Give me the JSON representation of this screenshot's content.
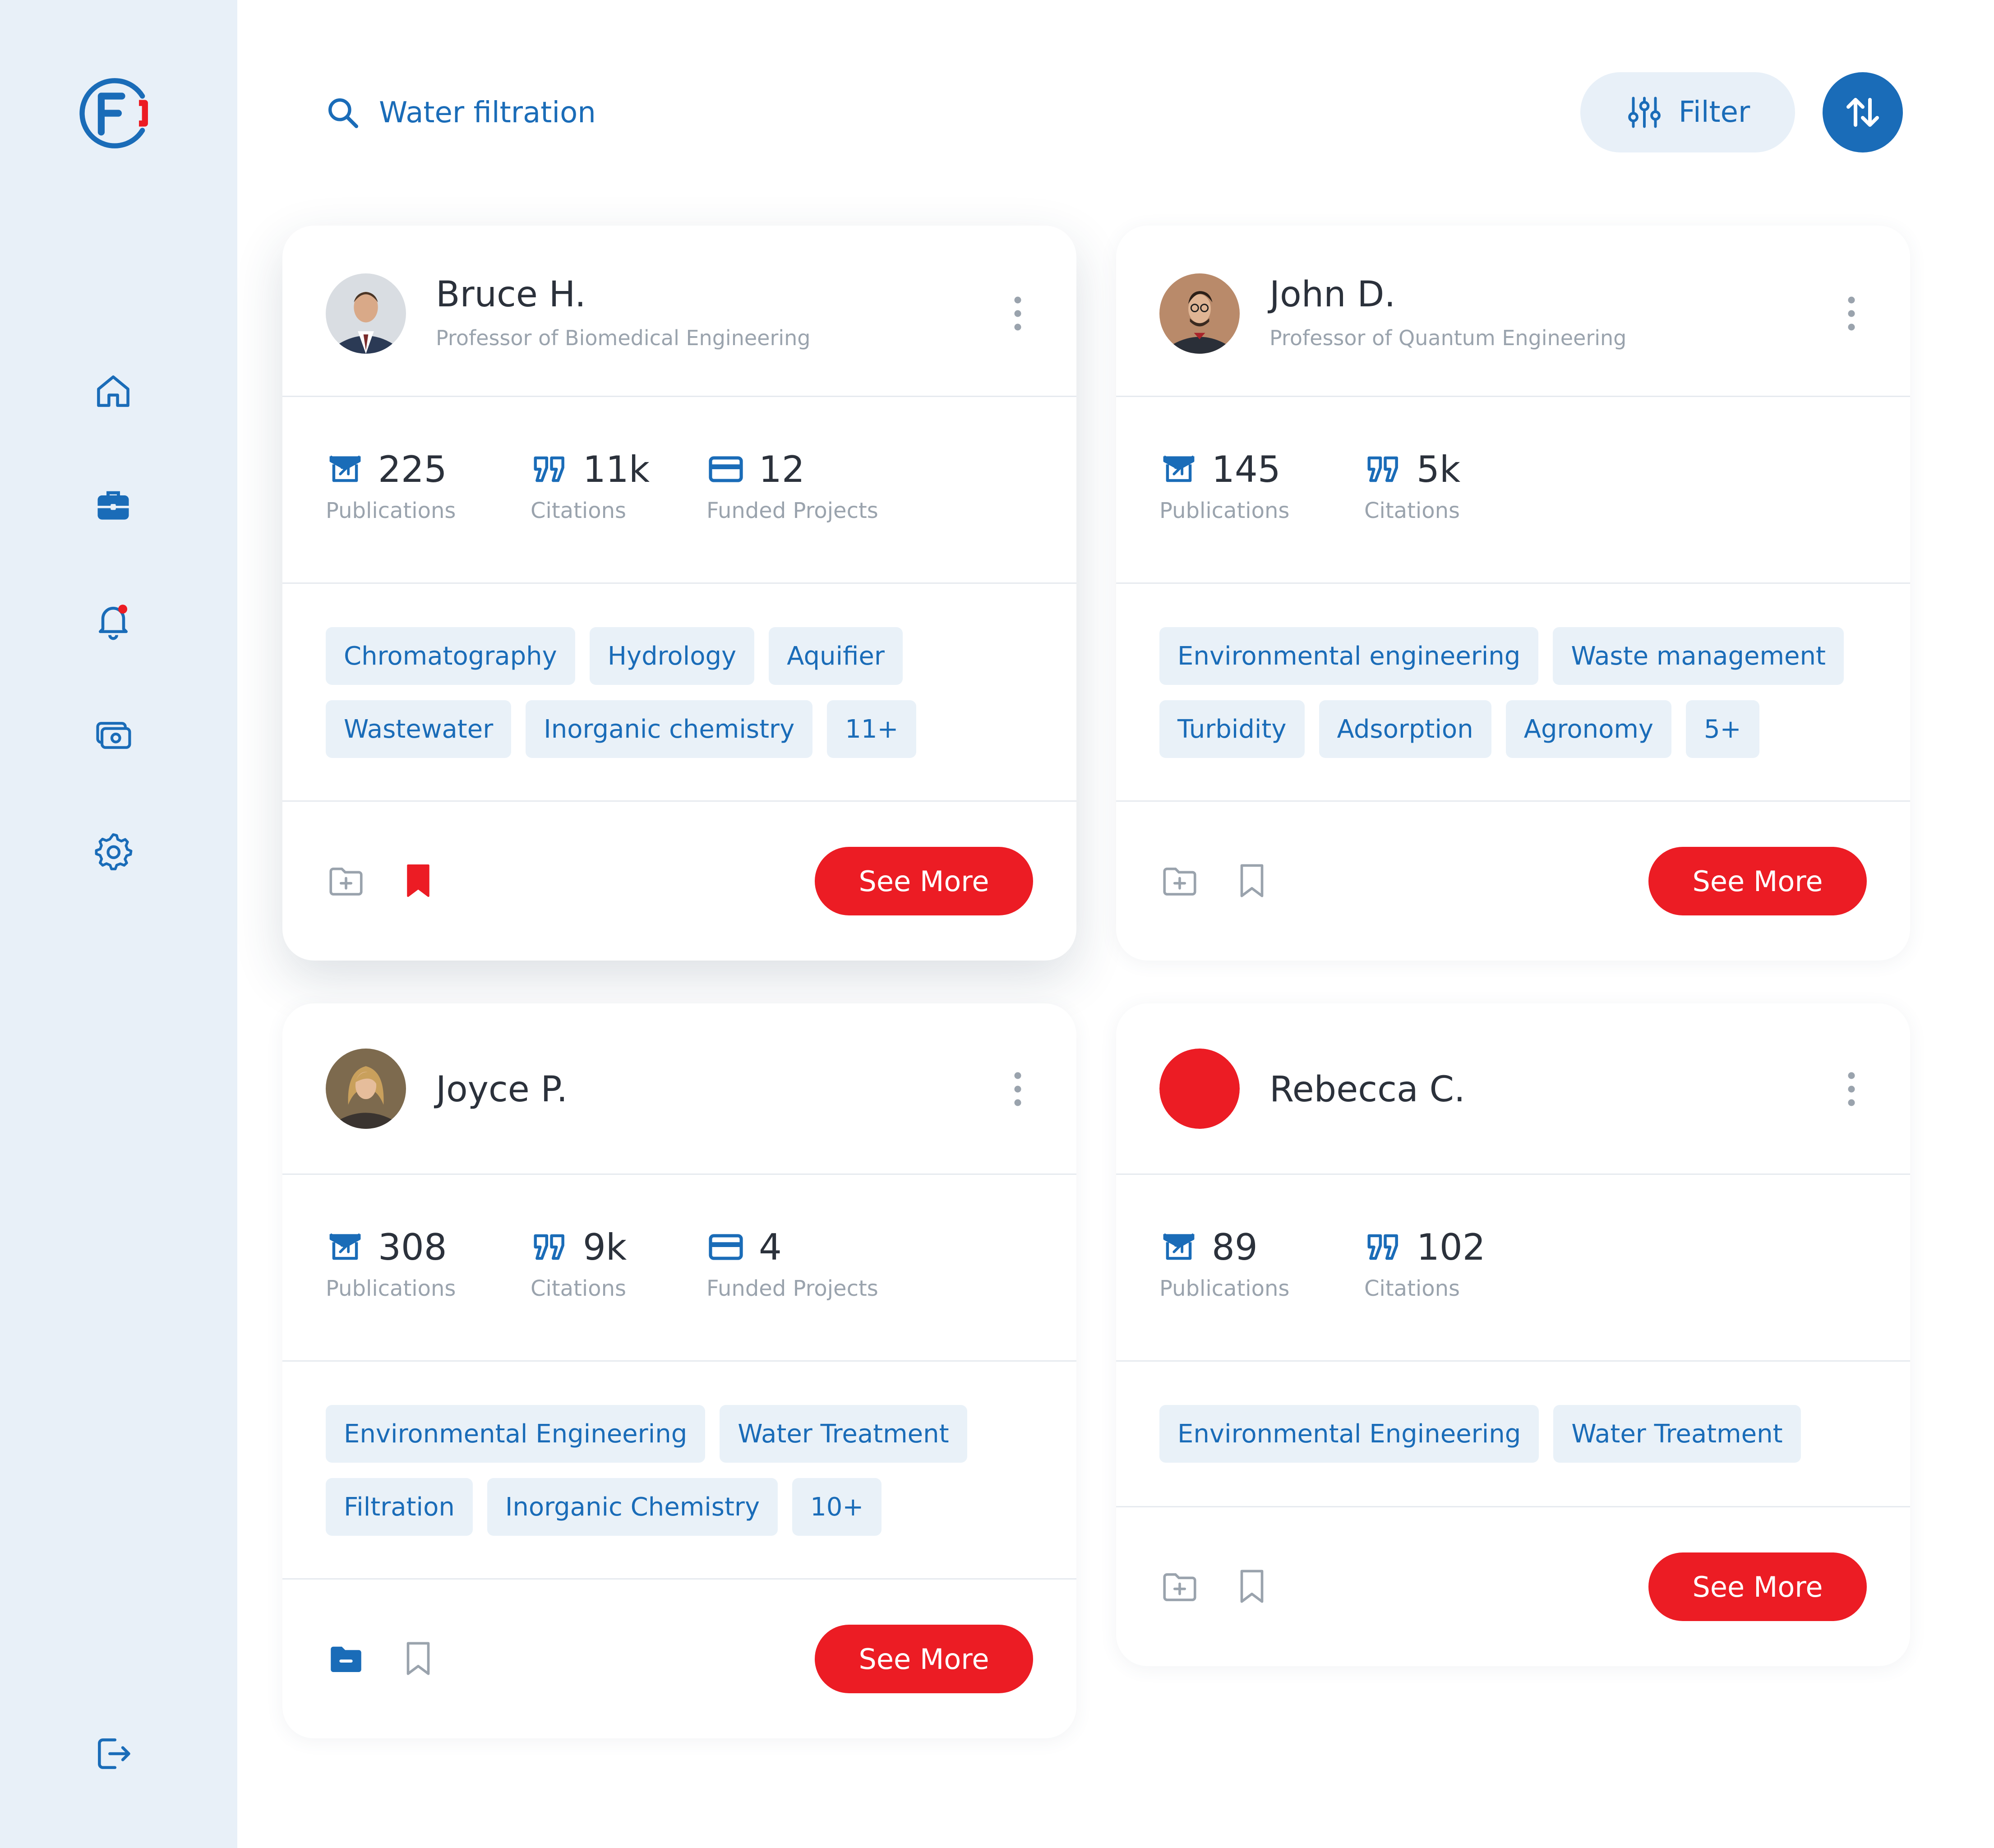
{
  "search": {
    "query": "Water filtration"
  },
  "toolbar": {
    "filter_label": "Filter"
  },
  "colors": {
    "primary": "#1a6cb8",
    "accent": "#ec1c24",
    "sidebar_bg": "#e8f0f8",
    "tag_bg": "#e9f1f8"
  },
  "sidebar": {
    "logo_icon": "brand-logo",
    "items": [
      {
        "icon": "home-icon"
      },
      {
        "icon": "briefcase-icon"
      },
      {
        "icon": "bell-icon",
        "has_notification": true
      },
      {
        "icon": "money-icon"
      },
      {
        "icon": "gear-icon"
      }
    ],
    "logout_icon": "logout-icon"
  },
  "cards": [
    {
      "name": "Bruce H.",
      "title": "Professor of Biomedical Engineering",
      "stats": {
        "publications": {
          "value": "225",
          "label": "Publications"
        },
        "citations": {
          "value": "11k",
          "label": "Citations"
        },
        "funded": {
          "value": "12",
          "label": "Funded Projects"
        }
      },
      "tags": [
        "Chromatography",
        "Hydrology",
        "Aquifier",
        "Wastewater",
        "Inorganic chemistry",
        "11+"
      ],
      "folder_state": "add",
      "bookmarked": true,
      "button_label": "See More"
    },
    {
      "name": "John D.",
      "title": "Professor of Quantum Engineering",
      "stats": {
        "publications": {
          "value": "145",
          "label": "Publications"
        },
        "citations": {
          "value": "5k",
          "label": "Citations"
        }
      },
      "tags": [
        "Environmental engineering",
        "Waste management",
        "Turbidity",
        "Adsorption",
        "Agronomy",
        "5+"
      ],
      "folder_state": "add",
      "bookmarked": false,
      "button_label": "See More"
    },
    {
      "name": "Joyce P.",
      "stats": {
        "publications": {
          "value": "308",
          "label": "Publications"
        },
        "citations": {
          "value": "9k",
          "label": "Citations"
        },
        "funded": {
          "value": "4",
          "label": "Funded Projects"
        }
      },
      "tags": [
        "Environmental Engineering",
        "Water Treatment",
        "Filtration",
        "Inorganic Chemistry",
        "10+"
      ],
      "folder_state": "saved",
      "bookmarked": false,
      "button_label": "See More"
    },
    {
      "name": "Rebecca C.",
      "stats": {
        "publications": {
          "value": "89",
          "label": "Publications"
        },
        "citations": {
          "value": "102",
          "label": "Citations"
        }
      },
      "tags": [
        "Environmental Engineering",
        "Water Treatment"
      ],
      "folder_state": "add",
      "bookmarked": false,
      "button_label": "See More"
    }
  ]
}
